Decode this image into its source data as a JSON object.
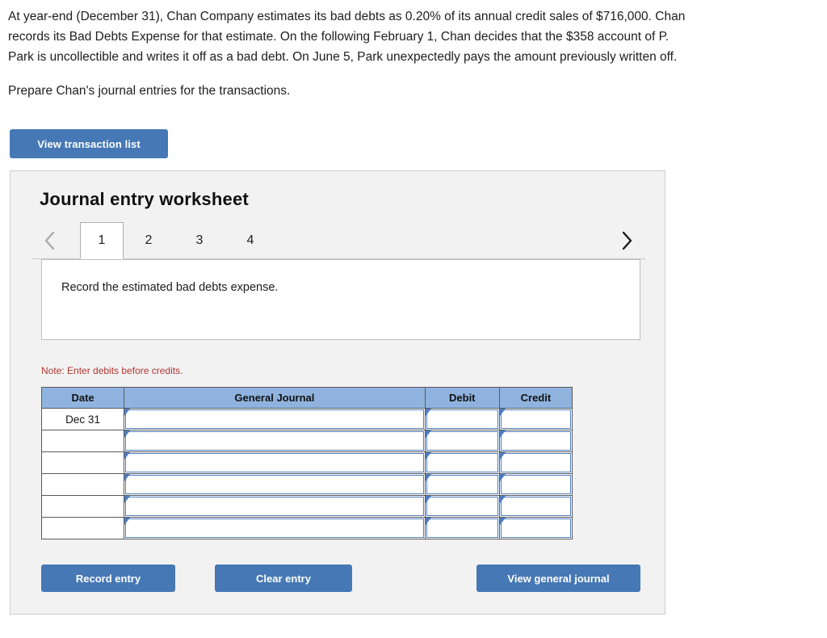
{
  "problem": {
    "lines": [
      "At year-end (December 31), Chan Company estimates its bad debts as 0.20% of its annual credit sales of $716,000. Chan",
      "records its Bad Debts Expense for that estimate. On the following February 1, Chan decides that the $358 account of P.",
      "Park is uncollectible and writes it off as a bad debt. On June 5, Park unexpectedly pays the amount previously written off."
    ],
    "prompt": "Prepare Chan's journal entries for the transactions."
  },
  "toolbar": {
    "view_transaction_list": "View transaction list"
  },
  "worksheet": {
    "title": "Journal entry worksheet",
    "prev_arrow_icon": "chevron-left-icon",
    "next_arrow_icon": "chevron-right-icon",
    "tabs": [
      {
        "label": "1",
        "active": true
      },
      {
        "label": "2",
        "active": false
      },
      {
        "label": "3",
        "active": false
      },
      {
        "label": "4",
        "active": false
      }
    ],
    "instruction": "Record the estimated bad debts expense.",
    "note": "Note: Enter debits before credits.",
    "table": {
      "headers": [
        "Date",
        "General Journal",
        "Debit",
        "Credit"
      ],
      "rows": [
        {
          "date": "Dec 31",
          "general_journal": "",
          "debit": "",
          "credit": ""
        },
        {
          "date": "",
          "general_journal": "",
          "debit": "",
          "credit": ""
        },
        {
          "date": "",
          "general_journal": "",
          "debit": "",
          "credit": ""
        },
        {
          "date": "",
          "general_journal": "",
          "debit": "",
          "credit": ""
        },
        {
          "date": "",
          "general_journal": "",
          "debit": "",
          "credit": ""
        },
        {
          "date": "",
          "general_journal": "",
          "debit": "",
          "credit": ""
        }
      ]
    },
    "actions": {
      "record_entry": "Record entry",
      "clear_entry": "Clear entry",
      "view_general_journal": "View general journal"
    }
  },
  "colors": {
    "button_blue": "#4678B5",
    "table_header_blue": "#8FB3DE",
    "note_red": "#B3362F",
    "panel_gray": "#F2F2F2"
  }
}
